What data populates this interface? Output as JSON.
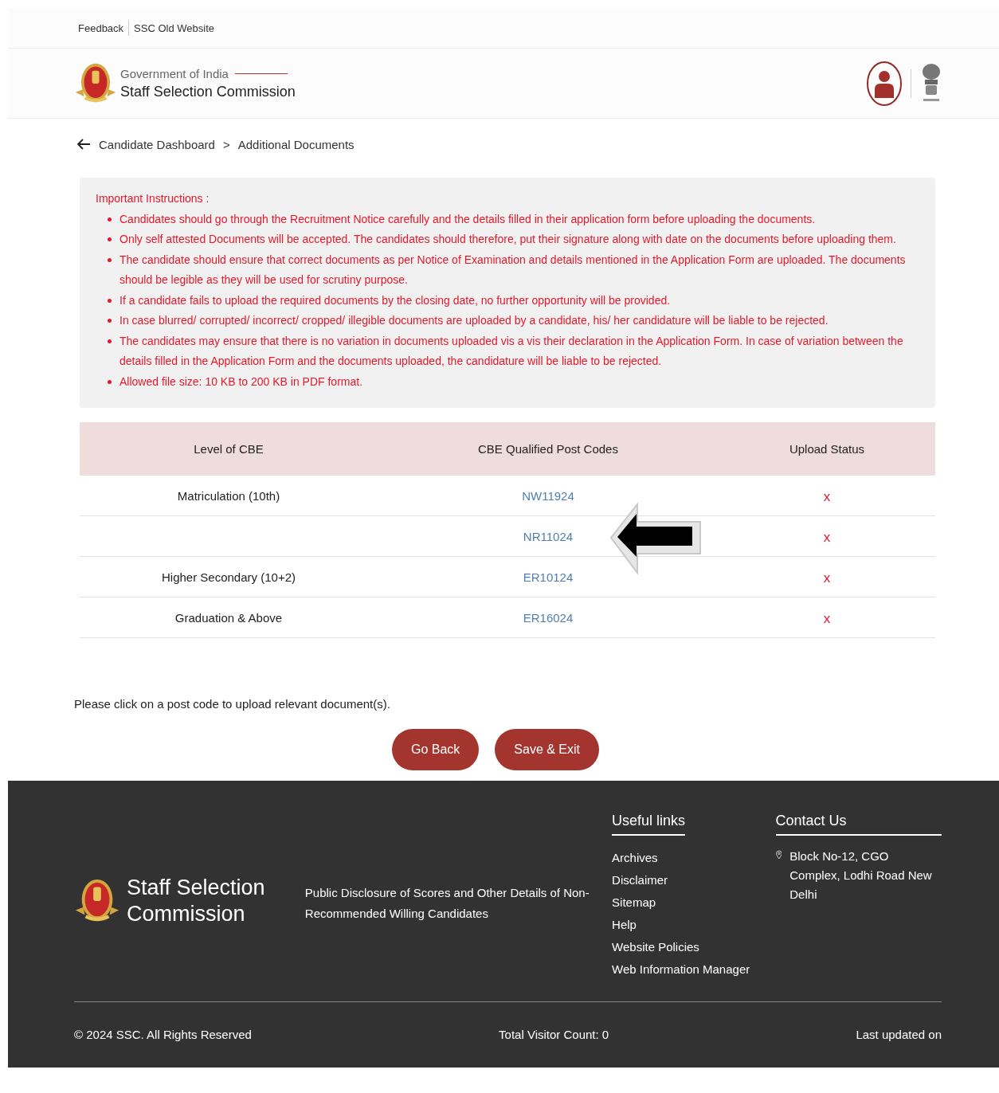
{
  "top_links": [
    "Feedback",
    "SSC Old Website"
  ],
  "header": {
    "subtitle": "Government of India",
    "title": "Staff Selection Commission"
  },
  "breadcrumb": {
    "parent": "Candidate Dashboard",
    "separator": ">",
    "current": "Additional Documents"
  },
  "instructions": {
    "heading": "Important Instructions :",
    "items": [
      "Candidates should go through the Recruitment Notice carefully and the details filled in their application form before uploading the documents.",
      "Only self attested Documents will be accepted. The candidates should therefore, put their signature along with date on the documents before uploading them.",
      "The candidate should ensure that correct documents as per Notice of Examination and details mentioned in the Application Form are uploaded. The documents should be legible as they will be used for scrutiny purpose.",
      "If a candidate fails to upload the required documents by the closing date, no further opportunity will be provided.",
      "In case blurred/ corrupted/ incorrect/ cropped/ illegible documents are uploaded by a candidate, his/ her candidature will be liable to be rejected.",
      "The candidates may ensure that there is no variation in documents uploaded vis a vis their declaration in the Application Form. In case of variation between the details filled in the Application Form and the documents uploaded, the candidature will be liable to be rejected.",
      "Allowed file size: 10 KB to 200 KB in PDF format."
    ]
  },
  "table": {
    "columns": [
      "Level of CBE",
      "CBE Qualified Post Codes",
      "Upload Status"
    ],
    "rows": [
      {
        "level": "Matriculation (10th)",
        "post_code": "NW11924",
        "status": "x"
      },
      {
        "post_code": "NR11024",
        "status": "x"
      },
      {
        "level": "Higher Secondary (10+2)",
        "post_code": "ER10124",
        "status": "x"
      },
      {
        "level": "Graduation & Above",
        "post_code": "ER16024",
        "status": "x"
      }
    ]
  },
  "note": "Please click on a post code to upload relevant document(s).",
  "buttons": [
    "Go Back",
    "Save & Exit"
  ],
  "footer": {
    "brand": "Staff Selection Commission",
    "disclosure": "Public Disclosure of Scores and Other Details of Non-Recommended Willing Candidates",
    "useful_links": {
      "heading": "Useful links",
      "items": [
        "Archives",
        "Disclaimer",
        "Sitemap",
        "Help",
        "Website Policies",
        "Web Information Manager"
      ]
    },
    "contact": {
      "heading": "Contact Us",
      "address": "Block No-12, CGO Complex, Lodhi Road New Delhi"
    },
    "copyright": "© 2024 SSC. All Rights Reserved",
    "visitor_count": "Total Visitor Count: 0",
    "last_updated": "Last updated on"
  }
}
